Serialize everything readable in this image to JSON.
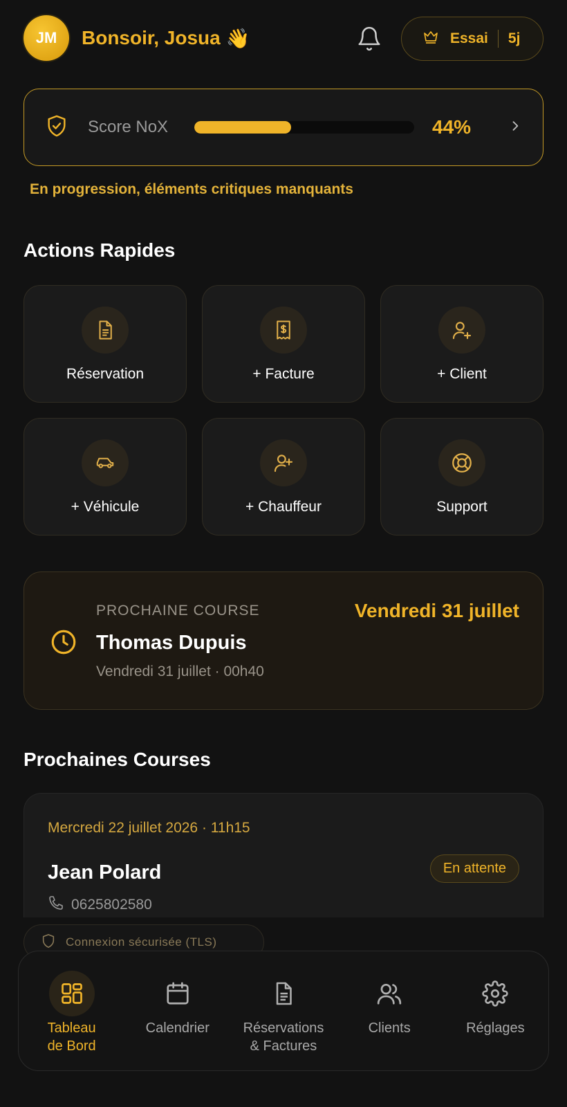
{
  "header": {
    "avatar_initials": "JM",
    "greeting": "Bonsoir, Josua",
    "wave_emoji": "👋",
    "trial_label": "Essai",
    "trial_days": "5j"
  },
  "score": {
    "label": "Score NoX",
    "value_text": "44%",
    "value": 0.44,
    "message": "En progression, éléments critiques manquants"
  },
  "quick_actions": {
    "title": "Actions Rapides",
    "items": [
      {
        "label": "Réservation",
        "icon": "document-icon"
      },
      {
        "label": "+ Facture",
        "icon": "receipt-icon"
      },
      {
        "label": "+ Client",
        "icon": "user-plus-icon"
      },
      {
        "label": "+ Véhicule",
        "icon": "car-icon"
      },
      {
        "label": "+ Chauffeur",
        "icon": "user-plus-icon"
      },
      {
        "label": "Support",
        "icon": "lifebuoy-icon"
      }
    ]
  },
  "next_course": {
    "kicker": "PROCHAINE COURSE",
    "date_highlight": "Vendredi 31 juillet",
    "name": "Thomas Dupuis",
    "details": "Vendredi 31 juillet · 00h40"
  },
  "upcoming": {
    "title": "Prochaines Courses",
    "items": [
      {
        "when": "Mercredi 22 juillet 2026 · 11h15",
        "name": "Jean Polard",
        "status": "En attente",
        "phone": "0625802580"
      }
    ]
  },
  "security_badge": "Connexion sécurisée (TLS)",
  "nav": {
    "items": [
      {
        "label": "Tableau\nde Bord",
        "icon": "dashboard-icon",
        "active": true
      },
      {
        "label": "Calendrier",
        "icon": "calendar-icon",
        "active": false
      },
      {
        "label": "Réservations\n& Factures",
        "icon": "document-icon",
        "active": false
      },
      {
        "label": "Clients",
        "icon": "users-icon",
        "active": false
      },
      {
        "label": "Réglages",
        "icon": "gear-icon",
        "active": false
      }
    ]
  },
  "colors": {
    "accent": "#f0b429",
    "background": "#121212",
    "card": "#1b1b1b"
  }
}
